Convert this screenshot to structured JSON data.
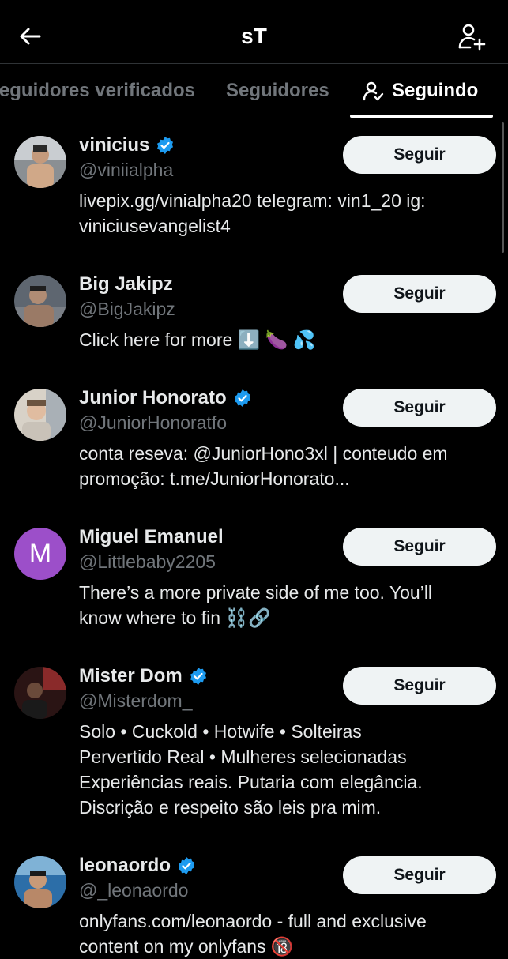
{
  "header": {
    "title": "sT"
  },
  "tabs": [
    {
      "label": "Seguidores verificados"
    },
    {
      "label": "Seguidores"
    },
    {
      "label": "Seguindo"
    }
  ],
  "users": [
    {
      "name": "vinicius",
      "handle": "@viniialpha",
      "bio": "livepix.gg/vinialpha20 telegram: vin1_20 ig:\nviniciusevangelist4",
      "verified": true,
      "follow_label": "Seguir"
    },
    {
      "name": "Big Jakipz",
      "handle": "@BigJakipz",
      "bio": "Click here for more ⬇️ 🍆 💦",
      "verified": false,
      "follow_label": "Seguir"
    },
    {
      "name": "Junior Honorato",
      "handle": "@JuniorHonoratfo",
      "bio": "conta reseva: @JuniorHono3xl | conteudo em\npromoção: t.me/JuniorHonorato...",
      "verified": true,
      "follow_label": "Seguir"
    },
    {
      "name": "Miguel Emanuel",
      "handle": "@Littlebaby2205",
      "bio": "There’s a more private side of me too. You’ll\nknow where to fin ⛓️🔗",
      "verified": false,
      "follow_label": "Seguir",
      "avatar_letter": "M"
    },
    {
      "name": "Mister Dom",
      "handle": "@Misterdom_",
      "bio": "Solo • Cuckold • Hotwife • Solteiras\nPervertido Real • Mulheres selecionadas\nExperiências reais. Putaria com elegância.\nDiscrição e respeito são leis pra mim.",
      "verified": true,
      "follow_label": "Seguir"
    },
    {
      "name": "leonaordo",
      "handle": "@_leonaordo",
      "bio": "onlyfans.com/leonaordo - full and exclusive\ncontent on my onlyfans 🔞",
      "verified": true,
      "follow_label": "Seguir"
    }
  ],
  "colors": {
    "background": "#000000",
    "verified": "#1d9bf0",
    "muted": "#71767b",
    "button": "#eff3f4"
  }
}
